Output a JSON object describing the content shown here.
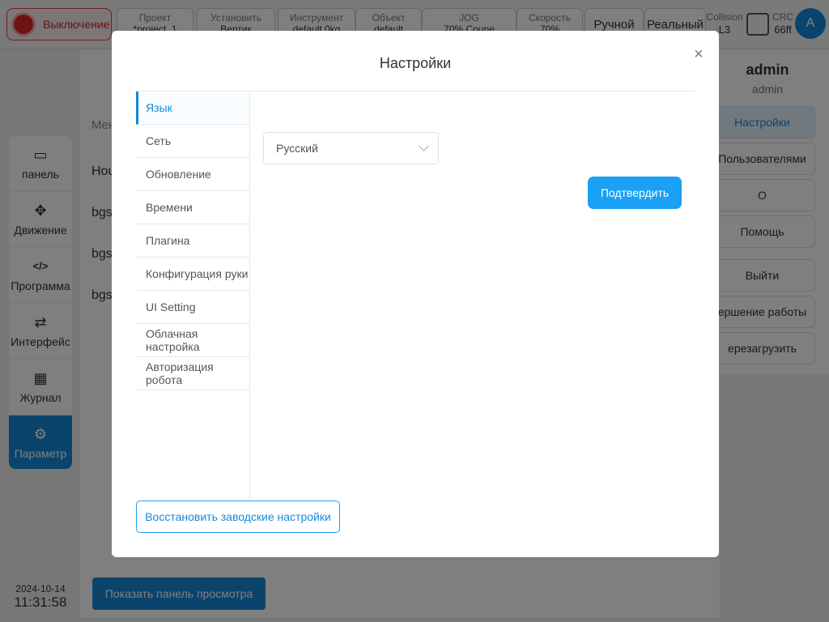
{
  "topbar": {
    "power_label": "Выключение",
    "cells": [
      {
        "title": "Проект",
        "value": "*project_1"
      },
      {
        "title": "Установить",
        "value": "Вертик"
      },
      {
        "title": "Инструмент",
        "value": "default   0kg"
      },
      {
        "title": "Объект",
        "value": "default"
      },
      {
        "title": "JOG",
        "value": "70%   Соune"
      },
      {
        "title": "Скорость",
        "value": "70%"
      }
    ],
    "mode_manual": "Ручной",
    "mode_real": "Реальный",
    "collision_label": "Collision",
    "collision_value": "L3",
    "crc_label": "CRC",
    "crc_value": "66ff",
    "avatar_letter": "A"
  },
  "leftnav": {
    "items": [
      {
        "label": "панель",
        "icon": "monitor-icon"
      },
      {
        "label": "Движение",
        "icon": "move-icon"
      },
      {
        "label": "Программа",
        "icon": "code-icon"
      },
      {
        "label": "Интерфейс",
        "icon": "swap-icon"
      },
      {
        "label": "Журнал",
        "icon": "calendar-icon"
      },
      {
        "label": "Параметр",
        "icon": "gear-icon"
      }
    ]
  },
  "clock": {
    "date": "2024-10-14",
    "time": "11:31:58"
  },
  "main": {
    "header": "Мен",
    "rows": [
      "Hou",
      "bgs",
      "bgs",
      "bgs"
    ],
    "show_panel_button": "Показать панель просмотра"
  },
  "userpanel": {
    "name": "admin",
    "role": "admin",
    "buttons": [
      "Настройки",
      "Пользователями",
      "О",
      "Помощь",
      "Выйти",
      "ершение работы",
      "ерезагрузить"
    ]
  },
  "dialog": {
    "title": "Настройки",
    "menu": [
      "Язык",
      "Сеть",
      "Обновление",
      "Времени",
      "Плагина",
      "Конфигурация руки",
      "UI Setting",
      "Облачная настройка",
      "Авторизация робота"
    ],
    "language_value": "Русский",
    "confirm_label": "Подтвердить",
    "reset_label": "Восстановить заводские настройки"
  }
}
